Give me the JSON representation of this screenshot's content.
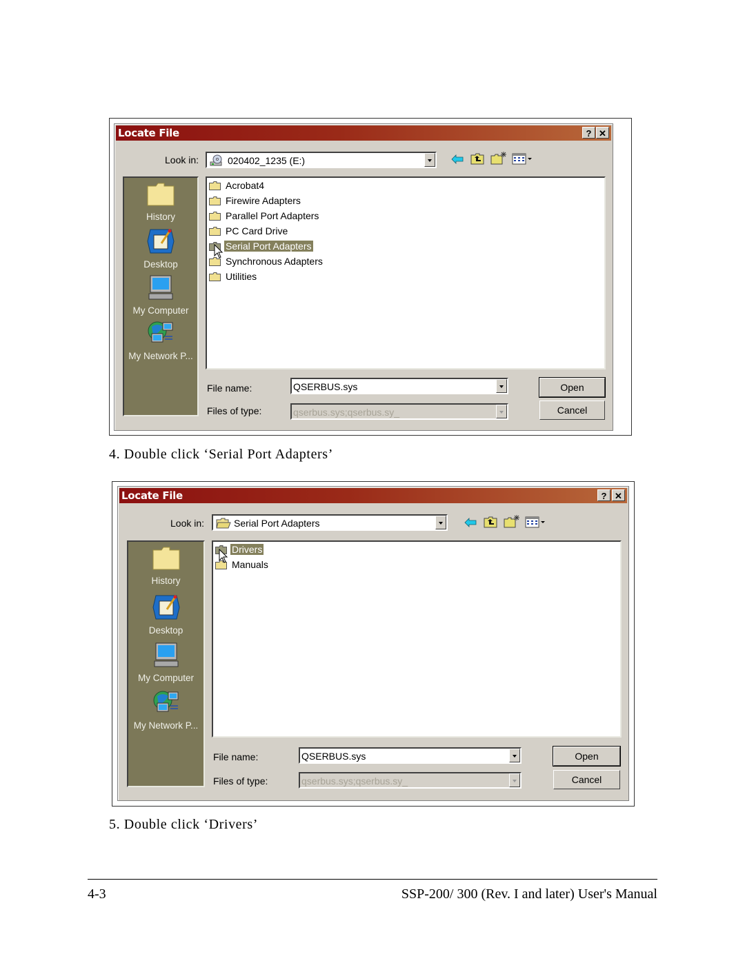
{
  "dialogs": [
    {
      "title": "Locate File",
      "help_button": "?",
      "close_button": "✕",
      "look_in_label": "Look in:",
      "look_in_value": "020402_1235 (E:)",
      "look_in_icon": "cd-drive-icon",
      "places": [
        {
          "label": "History",
          "icon": "history-folder-icon"
        },
        {
          "label": "Desktop",
          "icon": "desktop-icon"
        },
        {
          "label": "My Computer",
          "icon": "my-computer-icon"
        },
        {
          "label": "My Network P...",
          "icon": "network-places-icon"
        }
      ],
      "files": [
        {
          "name": "Acrobat4",
          "selected": false
        },
        {
          "name": "Firewire Adapters",
          "selected": false
        },
        {
          "name": "Parallel Port Adapters",
          "selected": false
        },
        {
          "name": "PC Card Drive",
          "selected": false
        },
        {
          "name": "Serial Port Adapters",
          "selected": true
        },
        {
          "name": "Synchronous Adapters",
          "selected": false
        },
        {
          "name": "Utilities",
          "selected": false
        }
      ],
      "file_name_label": "File name:",
      "file_name_value": "QSERBUS.sys",
      "file_type_label": "Files of type:",
      "file_type_value": "qserbus.sys;qserbus.sy_",
      "open_button": "Open",
      "cancel_button": "Cancel"
    },
    {
      "title": "Locate File",
      "help_button": "?",
      "close_button": "✕",
      "look_in_label": "Look in:",
      "look_in_value": "Serial Port Adapters",
      "look_in_icon": "open-folder-icon",
      "places": [
        {
          "label": "History",
          "icon": "history-folder-icon"
        },
        {
          "label": "Desktop",
          "icon": "desktop-icon"
        },
        {
          "label": "My Computer",
          "icon": "my-computer-icon"
        },
        {
          "label": "My Network P...",
          "icon": "network-places-icon"
        }
      ],
      "files": [
        {
          "name": "Drivers",
          "selected": true
        },
        {
          "name": "Manuals",
          "selected": false
        }
      ],
      "file_name_label": "File name:",
      "file_name_value": "QSERBUS.sys",
      "file_type_label": "Files of type:",
      "file_type_value": "qserbus.sys;qserbus.sy_",
      "open_button": "Open",
      "cancel_button": "Cancel"
    }
  ],
  "captions": {
    "step4": "4.  Double click ‘Serial Port Adapters’",
    "step5": "5.  Double click ‘Drivers’"
  },
  "footer": {
    "page_number": "4-3",
    "manual_title": "SSP-200/ 300 (Rev. I and later) User's Manual"
  }
}
